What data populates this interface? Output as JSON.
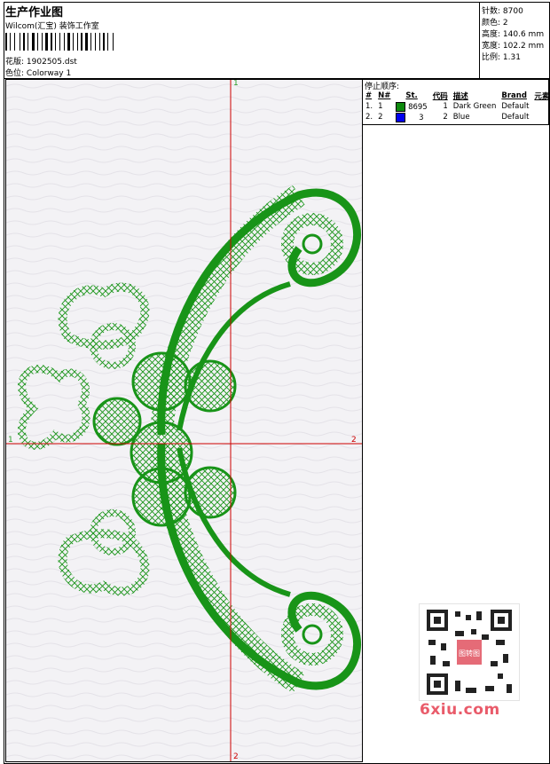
{
  "header": {
    "title": "生产作业图",
    "company": "Wilcom(汇宝) 装饰工作室",
    "design_label": "花版:",
    "design_value": "1902505.dst",
    "color_label": "色位:",
    "color_value": "Colorway 1"
  },
  "stats": [
    {
      "label": "针数:",
      "value": "8700"
    },
    {
      "label": "颜色:",
      "value": "2"
    },
    {
      "label": "高度:",
      "value": "140.6 mm"
    },
    {
      "label": "宽度:",
      "value": "102.2 mm"
    },
    {
      "label": "比例:",
      "value": "1.31"
    }
  ],
  "canvas": {
    "axis_top": "1",
    "axis_bottom": "2",
    "axis_left": "1",
    "axis_right": "2",
    "embroidery_color": "#189418",
    "background": "#f3f2f5",
    "axis_color": "#cc0000"
  },
  "stop_sequence": {
    "title": "停止顺序:",
    "headers": [
      "#",
      "N#",
      "St.",
      "代码",
      "描述",
      "Brand",
      "元素"
    ],
    "rows": [
      {
        "num": "1.",
        "n": "1",
        "color": "#0d8a0d",
        "st": "8695",
        "code": "1",
        "desc": "Dark Green",
        "brand": "Default"
      },
      {
        "num": "2.",
        "n": "2",
        "color": "#0000ee",
        "st": "3",
        "code": "2",
        "desc": "Blue",
        "brand": "Default"
      }
    ]
  },
  "watermark": {
    "site": "6xiu.com",
    "stamp": "图转图"
  }
}
